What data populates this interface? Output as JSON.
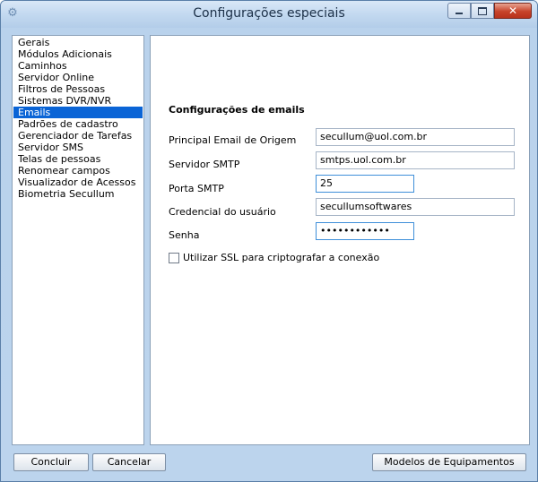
{
  "window": {
    "title": "Configurações especiais"
  },
  "sidebar": {
    "selected_index": 7,
    "items": [
      "Gerais",
      "Módulos Adicionais",
      "Caminhos",
      "Servidor Online",
      "Filtros de Pessoas",
      "Sistemas DVR/NVR",
      "Emails",
      "Padrões de cadastro",
      "Gerenciador de Tarefas",
      "Servidor SMS",
      "Telas de pessoas",
      "Renomear campos",
      "Visualizador de Acessos",
      "Biometria Secullum"
    ]
  },
  "email_settings": {
    "heading": "Configurações de emails",
    "sender_label": "Principal Email de Origem",
    "sender_value": "secullum@uol.com.br",
    "smtp_server_label": "Servidor SMTP",
    "smtp_server_value": "smtps.uol.com.br",
    "smtp_port_label": "Porta SMTP",
    "smtp_port_value": "25",
    "credential_label": "Credencial do usuário",
    "credential_value": "secullumsoftwares",
    "password_label": "Senha",
    "password_value": "••••••••••••",
    "ssl_label": "Utilizar SSL para criptografar a conexão",
    "ssl_checked": false
  },
  "footer": {
    "finish_label": "Concluir",
    "cancel_label": "Cancelar",
    "equipment_models_label": "Modelos de Equipamentos"
  }
}
